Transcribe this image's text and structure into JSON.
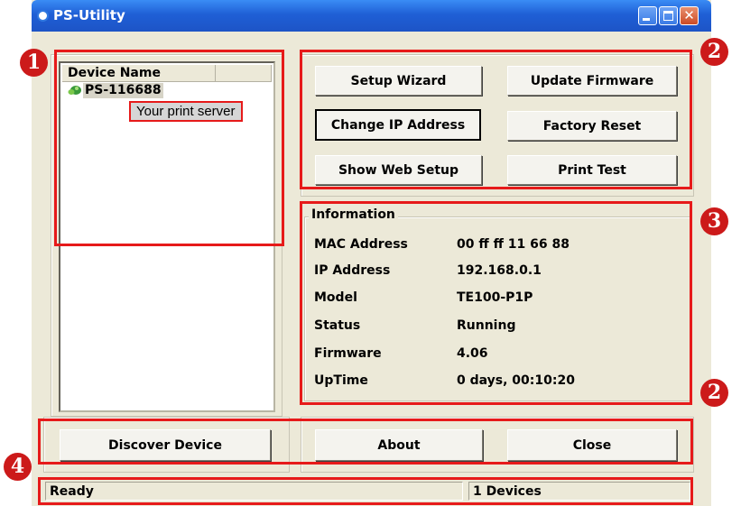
{
  "window": {
    "title": "PS-Utility",
    "controls": {
      "minimize": "minimize",
      "maximize": "maximize",
      "close": "✕"
    }
  },
  "device_list": {
    "columns": [
      "Device Name",
      ""
    ],
    "items": [
      {
        "name": "PS-116688",
        "icon": "printer-server-icon"
      }
    ],
    "tooltip": "Your print server"
  },
  "actions": {
    "setup_wizard": "Setup Wizard",
    "update_firmware": "Update Firmware",
    "change_ip": "Change IP Address",
    "factory_reset": "Factory Reset",
    "show_web_setup": "Show Web Setup",
    "print_test": "Print Test"
  },
  "information": {
    "title": "Information",
    "rows": [
      {
        "label": "MAC Address",
        "value": "00 ff ff 11 66 88"
      },
      {
        "label": "IP Address",
        "value": "192.168.0.1"
      },
      {
        "label": "Model",
        "value": "TE100-P1P"
      },
      {
        "label": "Status",
        "value": "Running"
      },
      {
        "label": "Firmware",
        "value": "4.06"
      },
      {
        "label": "UpTime",
        "value": "0 days, 00:10:20"
      }
    ]
  },
  "bottom_buttons": {
    "discover": "Discover Device",
    "about": "About",
    "close": "Close"
  },
  "status_bar": {
    "status": "Ready",
    "devices": "1 Devices"
  },
  "annotations": {
    "markers": [
      "1",
      "2",
      "3",
      "2",
      "4"
    ],
    "color": "#e61a1a"
  }
}
